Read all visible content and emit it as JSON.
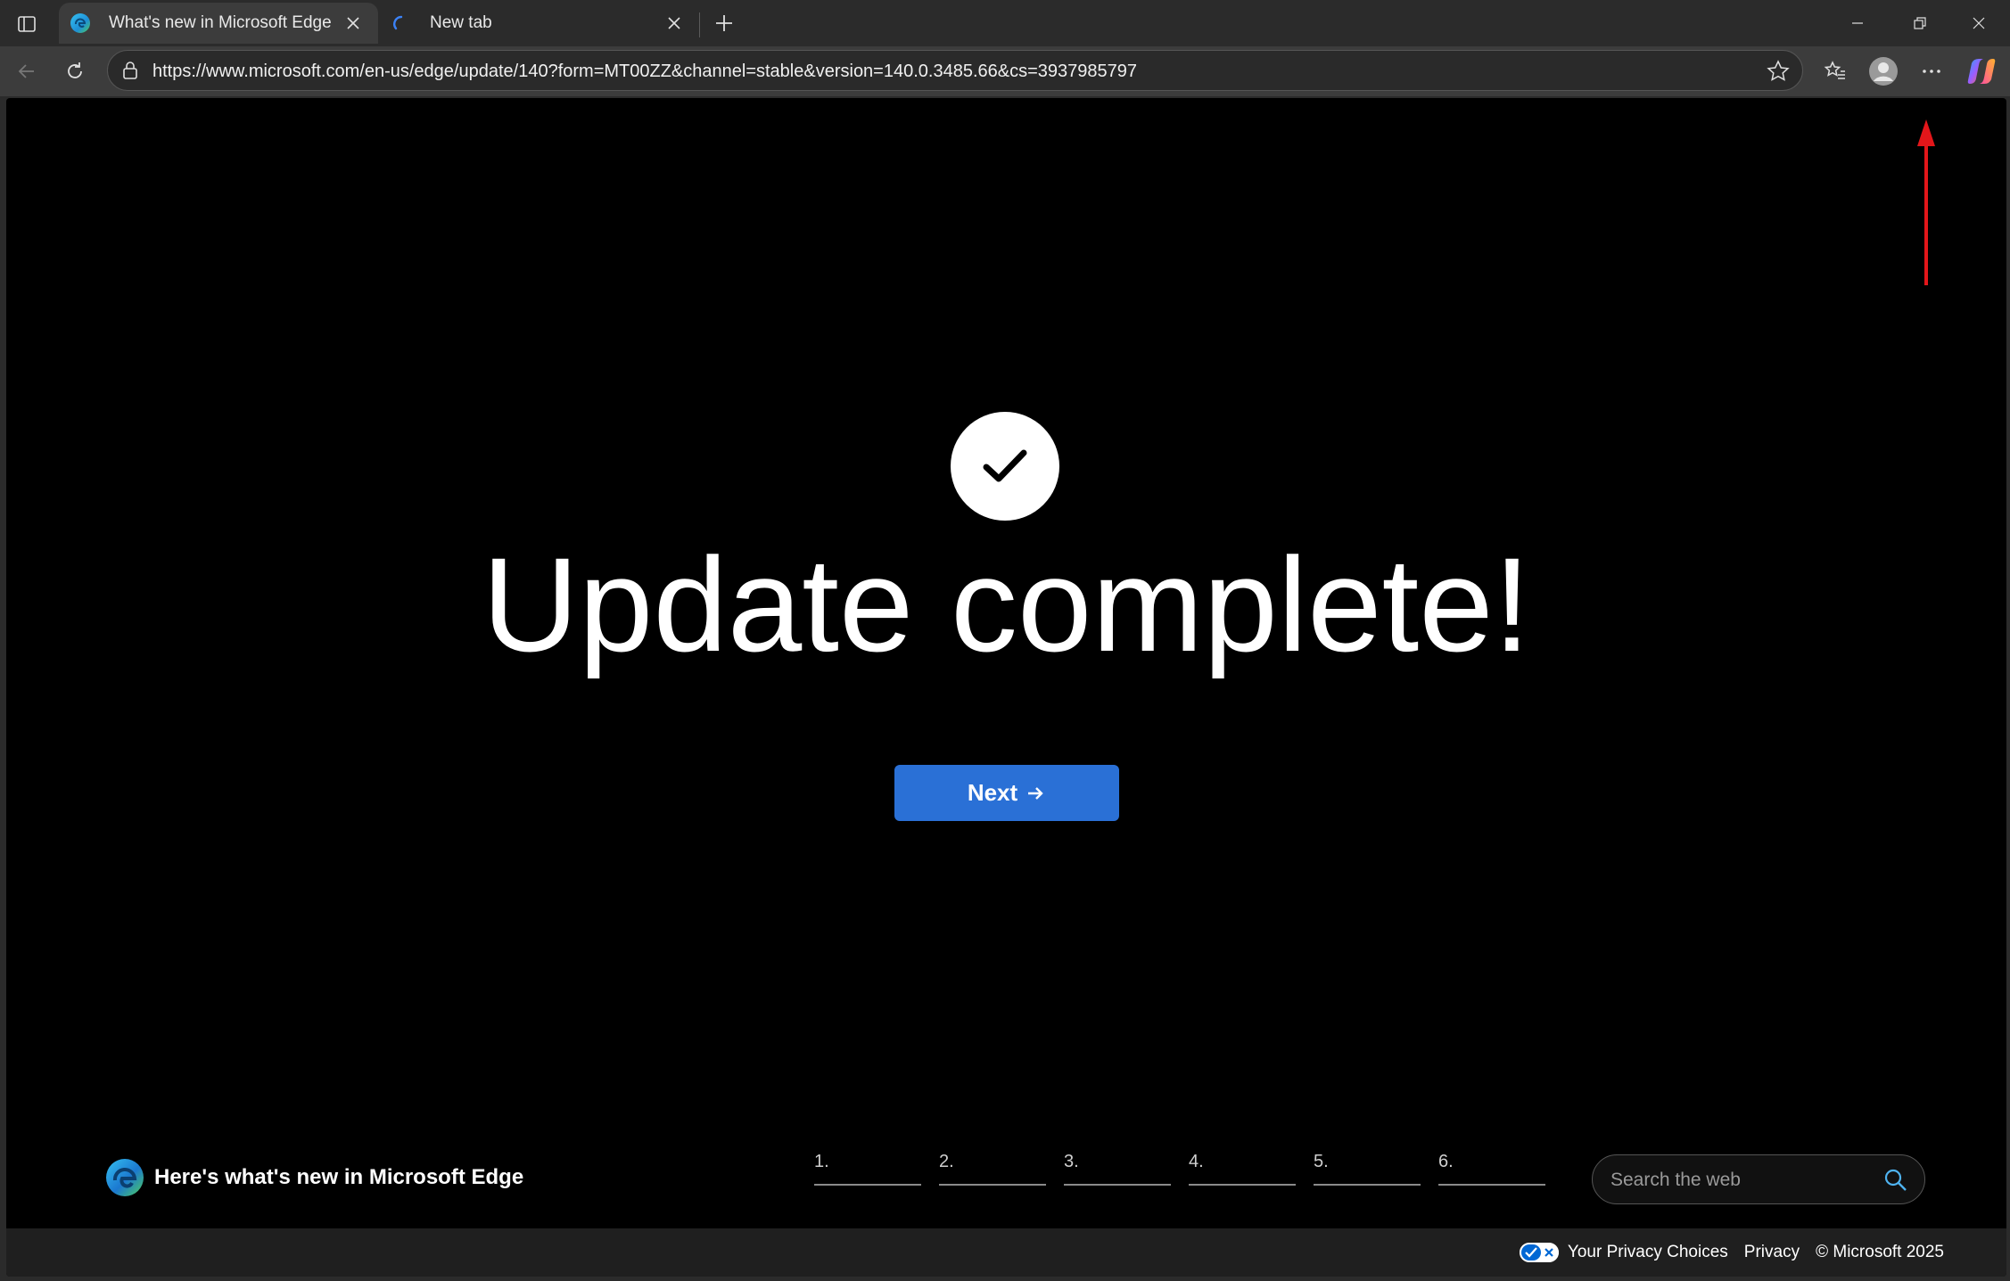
{
  "browser": {
    "tabs": [
      {
        "title": "What's new in Microsoft Edge",
        "active": true
      },
      {
        "title": "New tab",
        "active": false
      }
    ],
    "address_url": "https://www.microsoft.com/en-us/edge/update/140?form=MT00ZZ&channel=stable&version=140.0.3485.66&cs=3937985797"
  },
  "page": {
    "headline": "Update complete!",
    "next_button": "Next",
    "brand_text": "Here's what's new in Microsoft Edge",
    "steps": [
      "1.",
      "2.",
      "3.",
      "4.",
      "5.",
      "6."
    ],
    "search_placeholder": "Search the web",
    "footer": {
      "privacy_choices": "Your Privacy Choices",
      "privacy": "Privacy",
      "copyright": "© Microsoft 2025"
    }
  },
  "colors": {
    "accent": "#2a70d6",
    "annotation_arrow": "#e3161a"
  }
}
